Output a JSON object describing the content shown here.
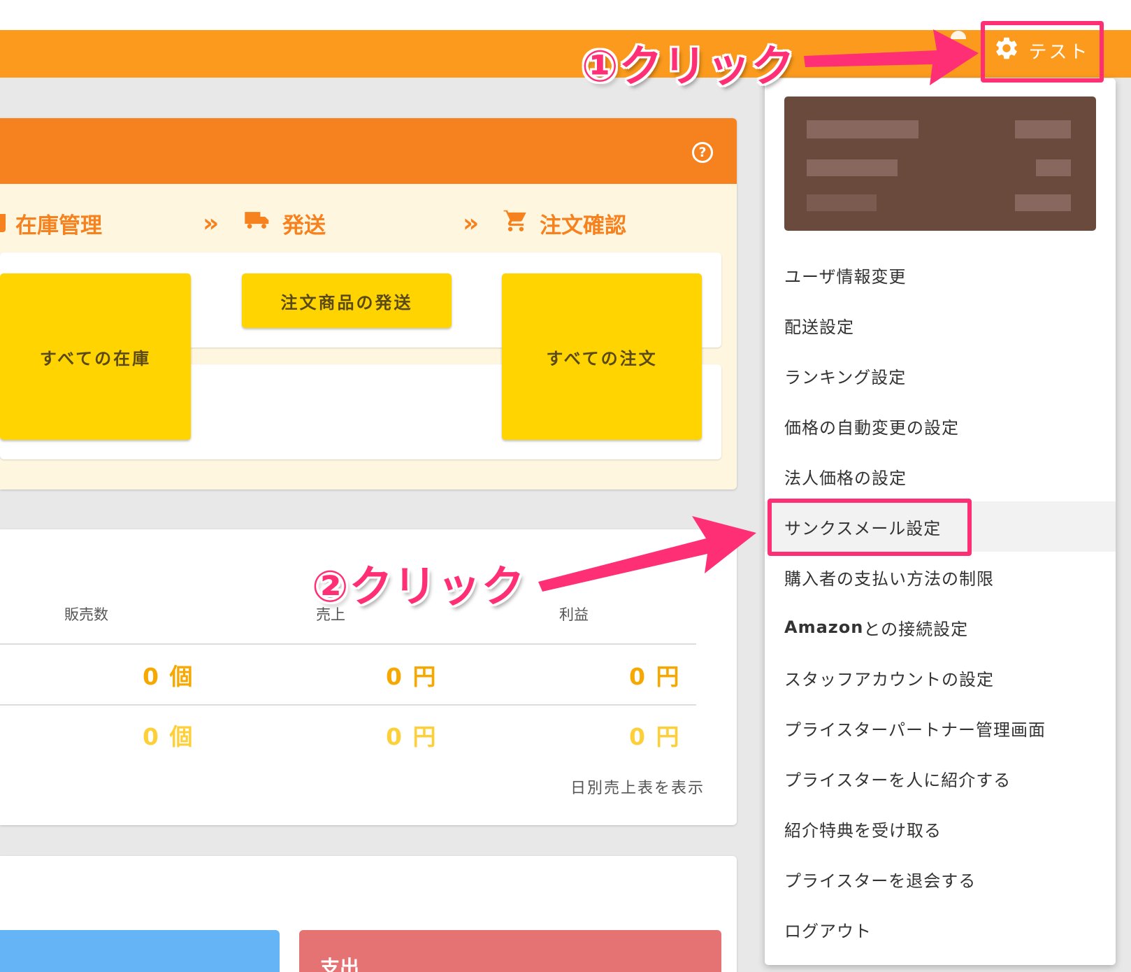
{
  "topbar": {
    "user_label": "テスト"
  },
  "flow": {
    "steps": [
      {
        "label": "在庫管理"
      },
      {
        "label": "発送"
      },
      {
        "label": "注文確認"
      }
    ],
    "buttons": {
      "all_stock": "すべての在庫",
      "ship_orders": "注文商品の発送",
      "all_orders": "すべての注文"
    }
  },
  "sales": {
    "columns": [
      "販売数",
      "売上",
      "利益"
    ],
    "rows": [
      [
        "0 個",
        "0 円",
        "0 円"
      ],
      [
        "0 個",
        "0 円",
        "0 円"
      ]
    ],
    "daily_link": "日別売上表を表示"
  },
  "balance": {
    "expense_label": "支出"
  },
  "dropdown": {
    "items": [
      "ユーザ情報変更",
      "配送設定",
      "ランキング設定",
      "価格の自動変更の設定",
      "法人価格の設定",
      "サンクスメール設定",
      "購入者の支払い方法の制限",
      "との接続設定",
      "スタッフアカウントの設定",
      "プライスターパートナー管理画面",
      "プライスターを人に紹介する",
      "紹介特典を受け取る",
      "プライスターを退会する",
      "ログアウト"
    ],
    "amazon_bold": "Amazon"
  },
  "annotations": {
    "step1": "①クリック",
    "step2": "②クリック",
    "accent": "#ff2f76"
  },
  "colors": {
    "topbar": "#fb9a1c",
    "flow_header": "#f5821f",
    "button_yellow": "#ffd400"
  }
}
